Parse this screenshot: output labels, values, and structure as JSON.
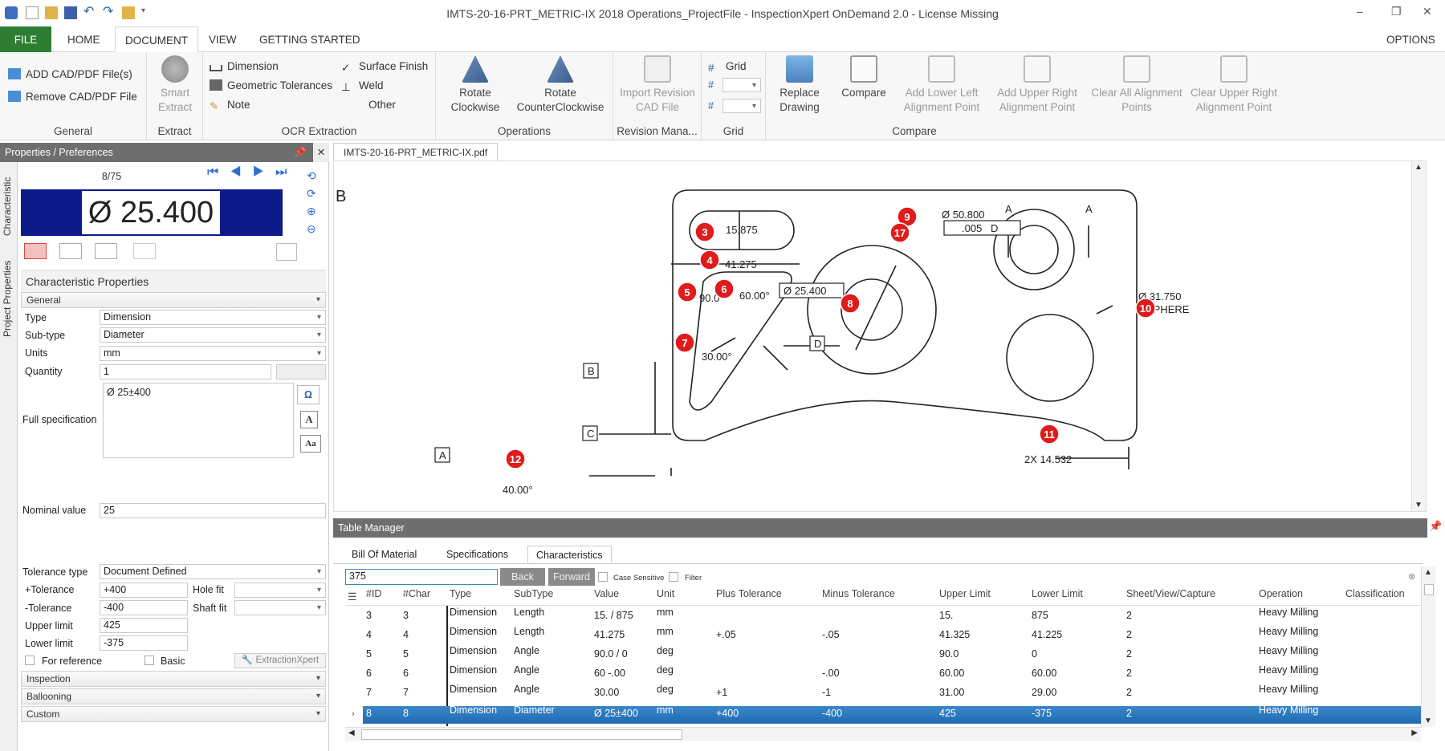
{
  "window": {
    "title": "IMTS-20-16-PRT_METRIC-IX 2018 Operations_ProjectFile - InspectionXpert OnDemand 2.0 - License Missing"
  },
  "ribbon_tabs": [
    "FILE",
    "HOME",
    "DOCUMENT",
    "VIEW",
    "GETTING STARTED"
  ],
  "options_label": "OPTIONS",
  "ribbon": {
    "general": {
      "add": "ADD CAD/PDF File(s)",
      "remove": "Remove CAD/PDF File",
      "label": "General"
    },
    "extract": {
      "smart": "Smart",
      "smart2": "Extract",
      "label": "Extract"
    },
    "ocr": {
      "dimension": "Dimension",
      "geo": "Geometric Tolerances",
      "note": "Note",
      "surface": "Surface Finish",
      "weld": "Weld",
      "other": "Other",
      "label": "OCR Extraction"
    },
    "operations": {
      "rot_cw1": "Rotate",
      "rot_cw2": "Clockwise",
      "rot_ccw1": "Rotate",
      "rot_ccw2": "CounterClockwise",
      "label": "Operations"
    },
    "revision": {
      "import1": "Import Revision",
      "import2": "CAD File",
      "label": "Revision Mana..."
    },
    "grid": {
      "grid": "Grid",
      "label": "Grid"
    },
    "compare": {
      "replace1": "Replace",
      "replace2": "Drawing",
      "compare": "Compare",
      "all1": "Add Lower Left",
      "all2": "Alignment Point",
      "aur1": "Add Upper Right",
      "aur2": "Alignment Point",
      "cal1": "Clear All Alignment",
      "cal2": "Points",
      "cur1": "Clear Upper Right",
      "cur2": "Alignment Point",
      "label": "Compare"
    }
  },
  "left": {
    "header": "Properties / Preferences",
    "vtab1": "Characteristic",
    "vtab2": "Project Properties",
    "counter": "8/75",
    "preview_text": "Ø 25.400",
    "section_title": "Characteristic Properties",
    "general": "General",
    "type_lbl": "Type",
    "type": "Dimension",
    "subtype_lbl": "Sub-type",
    "subtype": "Diameter",
    "units_lbl": "Units",
    "units": "mm",
    "qty_lbl": "Quantity",
    "qty": "1",
    "fullspec_lbl": "Full specification",
    "fullspec": "Ø 25±400",
    "nominal_lbl": "Nominal value",
    "nominal": "25",
    "toltype_lbl": "Tolerance type",
    "toltype": "Document Defined",
    "ptol_lbl": "+Tolerance",
    "ptol": "+400",
    "mtol_lbl": "-Tolerance",
    "mtol": "-400",
    "holefit_lbl": "Hole fit",
    "shaftfit_lbl": "Shaft fit",
    "upper_lbl": "Upper limit",
    "upper": "425",
    "lower_lbl": "Lower limit",
    "lower": "-375",
    "forref": "For reference",
    "basic": "Basic",
    "extractx": "ExtractionXpert",
    "inspection": "Inspection",
    "ballooning": "Ballooning",
    "custom": "Custom"
  },
  "doc_tab": "IMTS-20-16-PRT_METRIC-IX.pdf",
  "drawing": {
    "zoneB": "B",
    "balloons": [
      "3",
      "4",
      "5",
      "6",
      "7",
      "8",
      "9",
      "17",
      "10",
      "11",
      "12"
    ],
    "t_15875": "15.875",
    "t_41275": "41.275",
    "t_90": "90.0",
    "t_60": "60.00°",
    "t_30": "30.00°",
    "t_25400": "Ø 25.400",
    "t_50800": "Ø 50.800",
    "t_005": ".005",
    "t_D": "D",
    "t_31750": "Ø 31.750",
    "t_sphere": "SPHERE",
    "t_14532": "2X 14.532",
    "t_40": "40.00°",
    "datum_A": "A",
    "datum_B": "B",
    "datum_C": "C",
    "datum_D": "D"
  },
  "table": {
    "header": "Table Manager",
    "tabs": [
      "Bill Of Material",
      "Specifications",
      "Characteristics"
    ],
    "search": "375",
    "back": "Back",
    "forward": "Forward",
    "case": "Case Sensitive",
    "filter": "Filter",
    "columns": [
      "#ID",
      "#Char",
      "Type",
      "SubType",
      "Value",
      "Unit",
      "Plus Tolerance",
      "Minus Tolerance",
      "Upper Limit",
      "Lower Limit",
      "Sheet/View/Capture",
      "Operation",
      "Classification"
    ],
    "rows": [
      [
        "3",
        "3",
        "Dimension",
        "Length",
        "15. / 875",
        "mm",
        "",
        "",
        "15.",
        "875",
        "2",
        "Heavy Milling"
      ],
      [
        "4",
        "4",
        "Dimension",
        "Length",
        "41.275",
        "mm",
        "+.05",
        "-.05",
        "41.325",
        "41.225",
        "2",
        "Heavy Milling"
      ],
      [
        "5",
        "5",
        "Dimension",
        "Angle",
        "90.0 / 0",
        "deg",
        "",
        "",
        "90.0",
        "0",
        "2",
        "Heavy Milling"
      ],
      [
        "6",
        "6",
        "Dimension",
        "Angle",
        "60 -.00",
        "deg",
        "",
        "-.00",
        "60.00",
        "60.00",
        "2",
        "Heavy Milling"
      ],
      [
        "7",
        "7",
        "Dimension",
        "Angle",
        "30.00",
        "deg",
        "+1",
        "-1",
        "31.00",
        "29.00",
        "2",
        "Heavy Milling"
      ],
      [
        "8",
        "8",
        "Dimension",
        "Diameter",
        "Ø 25±400",
        "mm",
        "+400",
        "-400",
        "425",
        "-375",
        "2",
        "Heavy Milling"
      ]
    ]
  },
  "colors": {
    "file_tab": "#2e7d32",
    "balloon": "#e01b1b",
    "selection": "#1e6bb3",
    "preview_bg": "#0c1a8a"
  }
}
